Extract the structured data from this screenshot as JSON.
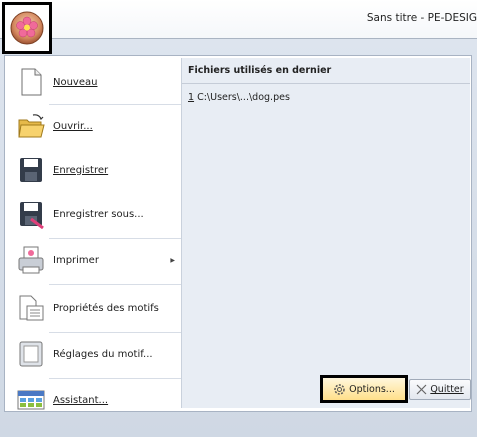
{
  "window": {
    "title": "Sans titre - PE-DESIG"
  },
  "menu": {
    "items": [
      {
        "label": "Nouveau",
        "icon": "new-document-icon"
      },
      {
        "label": "Ouvrir...",
        "icon": "open-folder-icon"
      },
      {
        "label": "Enregistrer",
        "icon": "save-icon"
      },
      {
        "label": "Enregistrer sous...",
        "icon": "save-as-icon"
      },
      {
        "label": "Imprimer",
        "icon": "printer-icon",
        "has_submenu": true
      },
      {
        "label": "Propriétés des motifs",
        "icon": "design-properties-icon"
      },
      {
        "label": "Réglages du motif...",
        "icon": "design-settings-icon"
      },
      {
        "label": "Assistant...",
        "icon": "wizard-icon"
      }
    ]
  },
  "recent": {
    "header": "Fichiers utilisés en dernier",
    "items": [
      {
        "index": "1",
        "path": "C:\\Users\\...\\dog.pes"
      }
    ]
  },
  "buttons": {
    "options": "Options...",
    "quit": "Quitter"
  },
  "colors": {
    "accent": "#ffd87a",
    "frame": "#d6dde7"
  }
}
